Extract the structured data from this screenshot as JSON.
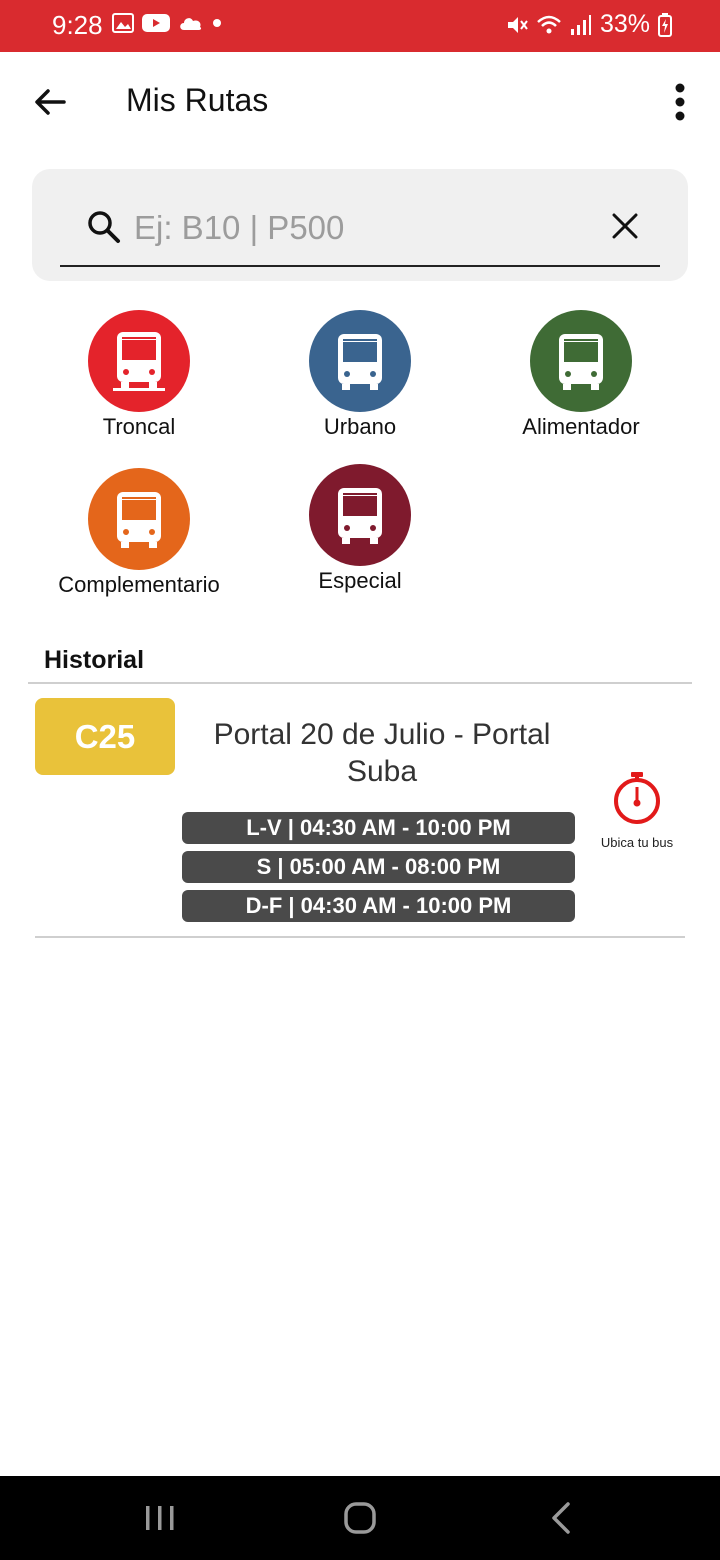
{
  "status_bar": {
    "time": "9:28",
    "battery": "33%",
    "background_color": "#d92b2f"
  },
  "app_bar": {
    "title": "Mis Rutas"
  },
  "search": {
    "placeholder": "Ej: B10 | P500",
    "value": ""
  },
  "categories": [
    {
      "label": "Troncal",
      "color": "#e4232b"
    },
    {
      "label": "Urbano",
      "color": "#3a648f"
    },
    {
      "label": "Alimentador",
      "color": "#3f6b35"
    },
    {
      "label": "Complementario",
      "color": "#e4661b"
    },
    {
      "label": "Especial",
      "color": "#7f1a2d"
    }
  ],
  "history": {
    "title": "Historial",
    "items": [
      {
        "code": "C25",
        "badge_color": "#e9c23a",
        "name": "Portal 20 de Julio - Portal Suba",
        "schedules": [
          "L-V | 04:30 AM - 10:00 PM",
          "S | 05:00 AM - 08:00 PM",
          "D-F | 04:30 AM - 10:00 PM"
        ],
        "action_label": "Ubica tu bus",
        "action_icon": "stopwatch-icon",
        "action_color": "#e21a1a"
      }
    ]
  },
  "icons": {
    "back": "arrow-left-icon",
    "more": "more-vertical-icon",
    "search": "search-icon",
    "clear": "close-icon",
    "category": "bus-icon",
    "nav_recent": "recent-apps-icon",
    "nav_home": "home-icon",
    "nav_back": "back-chevron-icon"
  }
}
